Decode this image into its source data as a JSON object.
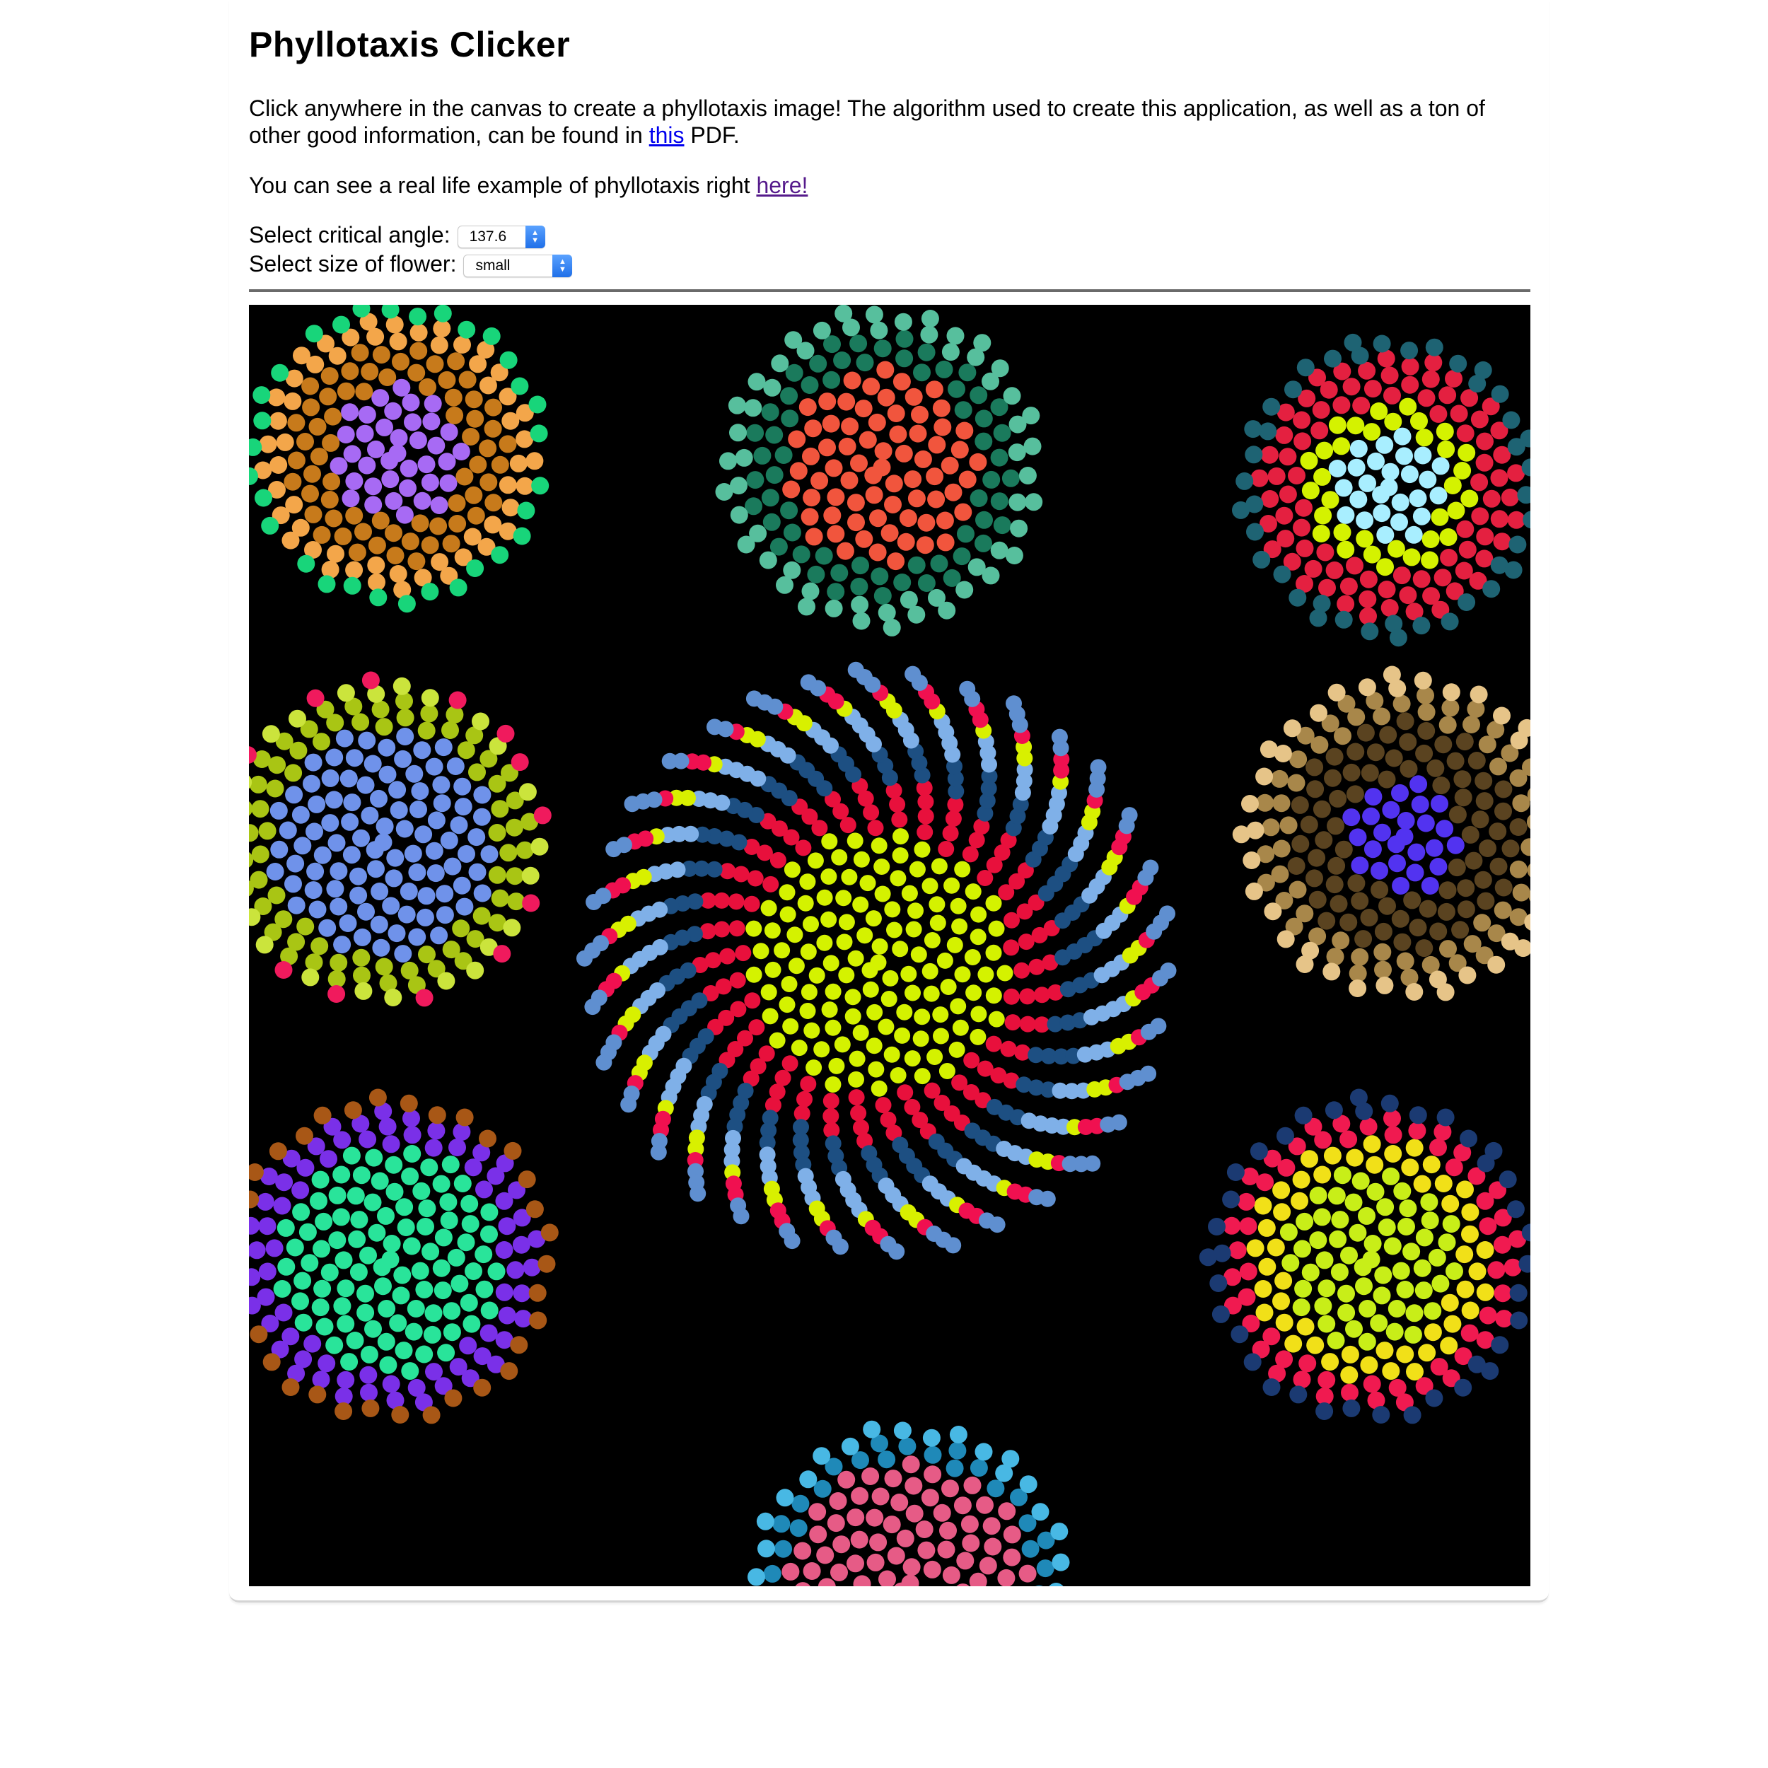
{
  "page": {
    "title": "Phyllotaxis Clicker",
    "intro_before_link": "Click anywhere in the canvas to create a phyllotaxis image! The algorithm used to create this application, as well as a ton of other good information, can be found in ",
    "intro_link": "this",
    "intro_after_link": " PDF.",
    "example_before_link": "You can see a real life example of phyllotaxis right ",
    "example_link": "here!"
  },
  "controls": {
    "angle_label": "Select critical angle:",
    "angle_value": "137.6",
    "size_label": "Select size of flower:",
    "size_value": "small"
  },
  "colors": {
    "canvas_background": "#000000",
    "link": "#0000ee",
    "visited_link": "#551a8b",
    "select_arrow": "#2f80ed"
  },
  "icons": {
    "select_arrow": "up-down-chevron-icon"
  }
}
